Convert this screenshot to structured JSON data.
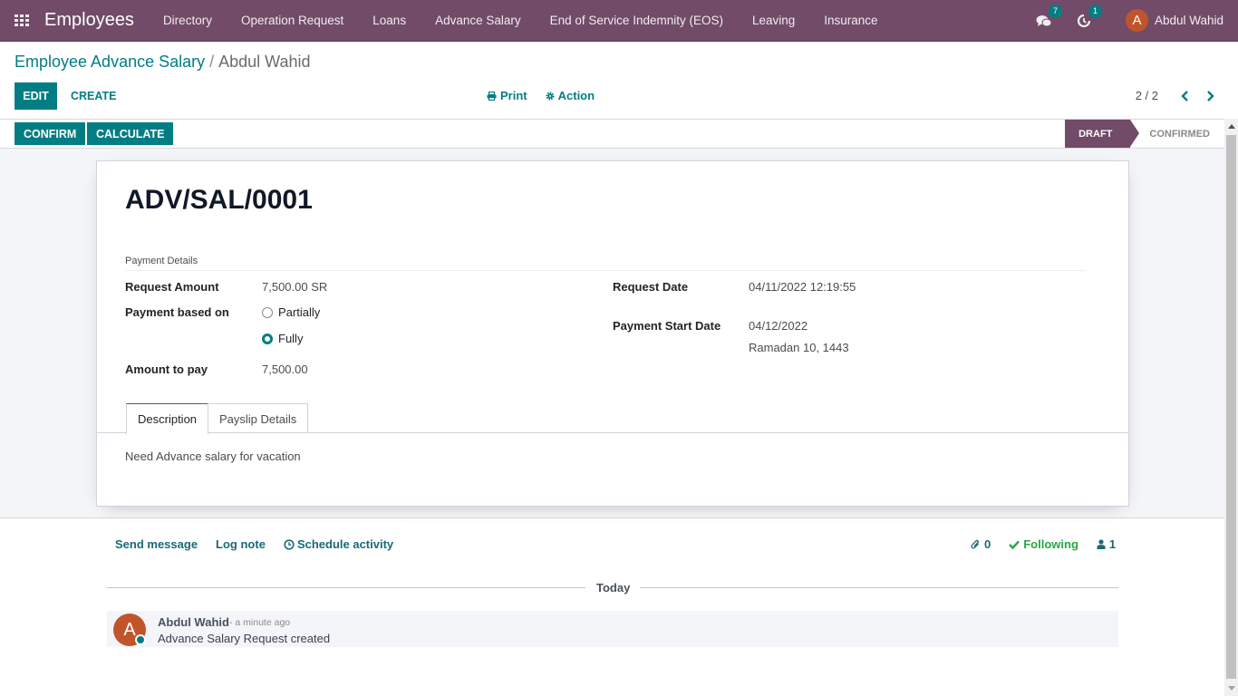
{
  "navbar": {
    "app_name": "Employees",
    "menu": [
      "Directory",
      "Operation Request",
      "Loans",
      "Advance Salary",
      "End of Service Indemnity (EOS)",
      "Leaving",
      "Insurance"
    ],
    "messages_count": "7",
    "activities_count": "1",
    "user_initial": "A",
    "user_name": "Abdul Wahid",
    "brand_color": "#714b67"
  },
  "breadcrumb": {
    "parent": "Employee Advance Salary",
    "separator": "/",
    "current": "Abdul Wahid"
  },
  "control_panel": {
    "edit_label": "EDIT",
    "create_label": "CREATE",
    "print_label": "Print",
    "action_label": "Action",
    "pager": "2 / 2"
  },
  "statusbar": {
    "confirm_label": "CONFIRM",
    "calculate_label": "CALCULATE",
    "steps": [
      {
        "label": "DRAFT",
        "active": true
      },
      {
        "label": "CONFIRMED",
        "active": false
      }
    ]
  },
  "form": {
    "record_name": "ADV/SAL/0001",
    "group_title": "Payment Details",
    "request_amount_label": "Request Amount",
    "request_amount": "7,500.00 SR",
    "payment_based_label": "Payment based on",
    "payment_options": [
      {
        "label": "Partially",
        "checked": false
      },
      {
        "label": "Fully",
        "checked": true
      }
    ],
    "amount_to_pay_label": "Amount to pay",
    "amount_to_pay": "7,500.00",
    "request_date_label": "Request Date",
    "request_date": "04/11/2022 12:19:55",
    "payment_start_label": "Payment Start Date",
    "payment_start_date": "04/12/2022",
    "payment_start_hijri": "Ramadan 10, 1443",
    "tabs": [
      "Description",
      "Payslip Details"
    ],
    "active_tab": "Description",
    "description": "Need Advance salary for vacation"
  },
  "chatter": {
    "send_message": "Send message",
    "log_note": "Log note",
    "schedule_activity": "Schedule activity",
    "attachments_count": "0",
    "following_label": "Following",
    "followers_count": "1",
    "date_separator": "Today",
    "messages": [
      {
        "author_initial": "A",
        "author": "Abdul Wahid",
        "date": "- a minute ago",
        "body": "Advance Salary Request created"
      }
    ]
  },
  "colors": {
    "primary": "#017e84",
    "brand": "#714b67",
    "following": "#28a745",
    "avatar": "#c0552b"
  }
}
